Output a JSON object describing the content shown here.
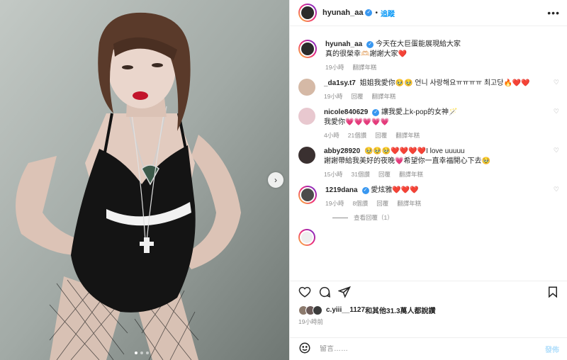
{
  "post": {
    "username": "hyunah_aa",
    "follow_label": "追蹤",
    "more_icon": "more-horizontal-icon",
    "caption": "今天在大巨蛋能展現給大家\n真的很榮幸🫶🏻謝謝大家❤️",
    "caption_time": "19小時",
    "caption_translate": "翻譯年糕"
  },
  "comments": [
    {
      "username": "_da1sy.t7",
      "verified": false,
      "text": "姐姐我愛你🥹🥹 언니 사랑해요ㅠㅠㅠㅠ 최고당🔥❤️❤️",
      "time": "19小時",
      "likes": "",
      "reply": "回覆",
      "translate": "翻譯年糕"
    },
    {
      "username": "nicole840629",
      "verified": true,
      "text": "讓我愛上k-pop的女神🪄\n我愛你💗💗💗💗💗",
      "time": "4小時",
      "likes": "21個讚",
      "reply": "回覆",
      "translate": "翻譯年糕"
    },
    {
      "username": "abby28920",
      "verified": false,
      "text": "🥹🥹🥹❤️❤️❤️❤️I love uuuuu\n謝謝帶給我美好的夜晚💗希望你一直幸福開心下去🥹",
      "time": "15小時",
      "likes": "31個讚",
      "reply": "回覆",
      "translate": "翻譯年糕"
    },
    {
      "username": "1219dana",
      "verified": true,
      "text": "愛炫雅❤️❤️❤️",
      "time": "19小時",
      "likes": "8個讚",
      "reply": "回覆",
      "translate": "翻譯年糕"
    }
  ],
  "view_replies_label": "查看回覆（1）",
  "likes_summary": {
    "first_user": "c.yiii__1127",
    "rest": "和其他31.3萬人都說讚"
  },
  "post_time": "19小時前",
  "composer": {
    "placeholder": "留言……",
    "post_label": "發佈"
  },
  "colors": {
    "accent": "#0095f6",
    "muted": "#8e8e8e",
    "verified": "#3897f0"
  }
}
